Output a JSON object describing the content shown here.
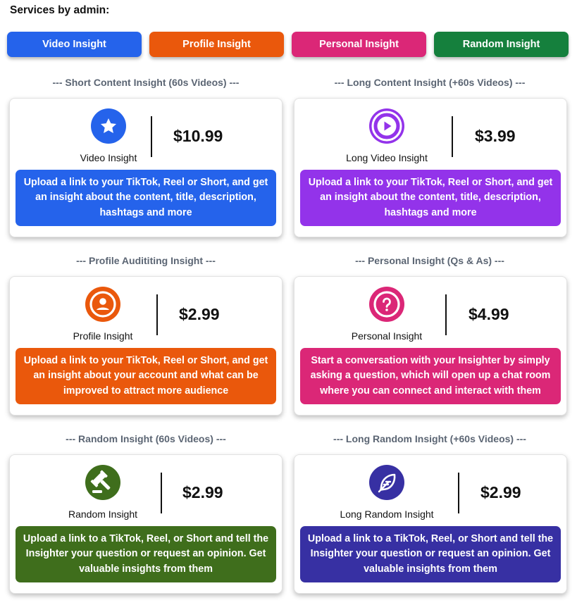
{
  "page": {
    "title": "Services by admin:"
  },
  "tabs": [
    {
      "label": "Video Insight",
      "color": "#2563eb"
    },
    {
      "label": "Profile Insight",
      "color": "#ea580c"
    },
    {
      "label": "Personal Insight",
      "color": "#db2777"
    },
    {
      "label": "Random Insight",
      "color": "#15803d"
    }
  ],
  "sections": [
    {
      "label": "--- Short Content Insight (60s Videos) ---"
    },
    {
      "label": "--- Long Content Insight (+60s Videos) ---"
    },
    {
      "label": "--- Profile Audititing Insight ---"
    },
    {
      "label": "--- Personal Insight (Qs & As) ---"
    },
    {
      "label": "--- Random Insight (60s Videos) ---"
    },
    {
      "label": "--- Long Random Insight (+60s Videos) ---"
    }
  ],
  "cards": [
    {
      "name": "Video Insight",
      "price": "$10.99",
      "icon": "star-icon",
      "color": "#2563eb",
      "description": "Upload a link to your TikTok, Reel or Short, and get an insight about the content, title, description, hashtags and more"
    },
    {
      "name": "Long Video Insight",
      "price": "$3.99",
      "icon": "play-icon",
      "color": "#9333ea",
      "description": "Upload a link to your TikTok, Reel or Short, and get an insight about the content, title, description, hashtags and more"
    },
    {
      "name": "Profile Insight",
      "price": "$2.99",
      "icon": "user-icon",
      "color": "#ea580c",
      "description": "Upload a link to your TikTok, Reel or Short, and get an insight about your account and what can be improved to attract more audience"
    },
    {
      "name": "Personal Insight",
      "price": "$4.99",
      "icon": "question-icon",
      "color": "#db2777",
      "description": "Start a conversation with your Insighter by simply asking a question, which will open up a chat room where you can connect and interact with them"
    },
    {
      "name": "Random Insight",
      "price": "$2.99",
      "icon": "gavel-icon",
      "color": "#3f6e1c",
      "description": "Upload a link to a TikTok, Reel, or Short and tell the Insighter your question or request an opinion. Get valuable insights from them"
    },
    {
      "name": "Long Random Insight",
      "price": "$2.99",
      "icon": "feather-icon",
      "color": "#3730a3",
      "description": "Upload a link to a TikTok, Reel, or Short and tell the Insighter your question or request an opinion. Get valuable insights from them"
    }
  ]
}
